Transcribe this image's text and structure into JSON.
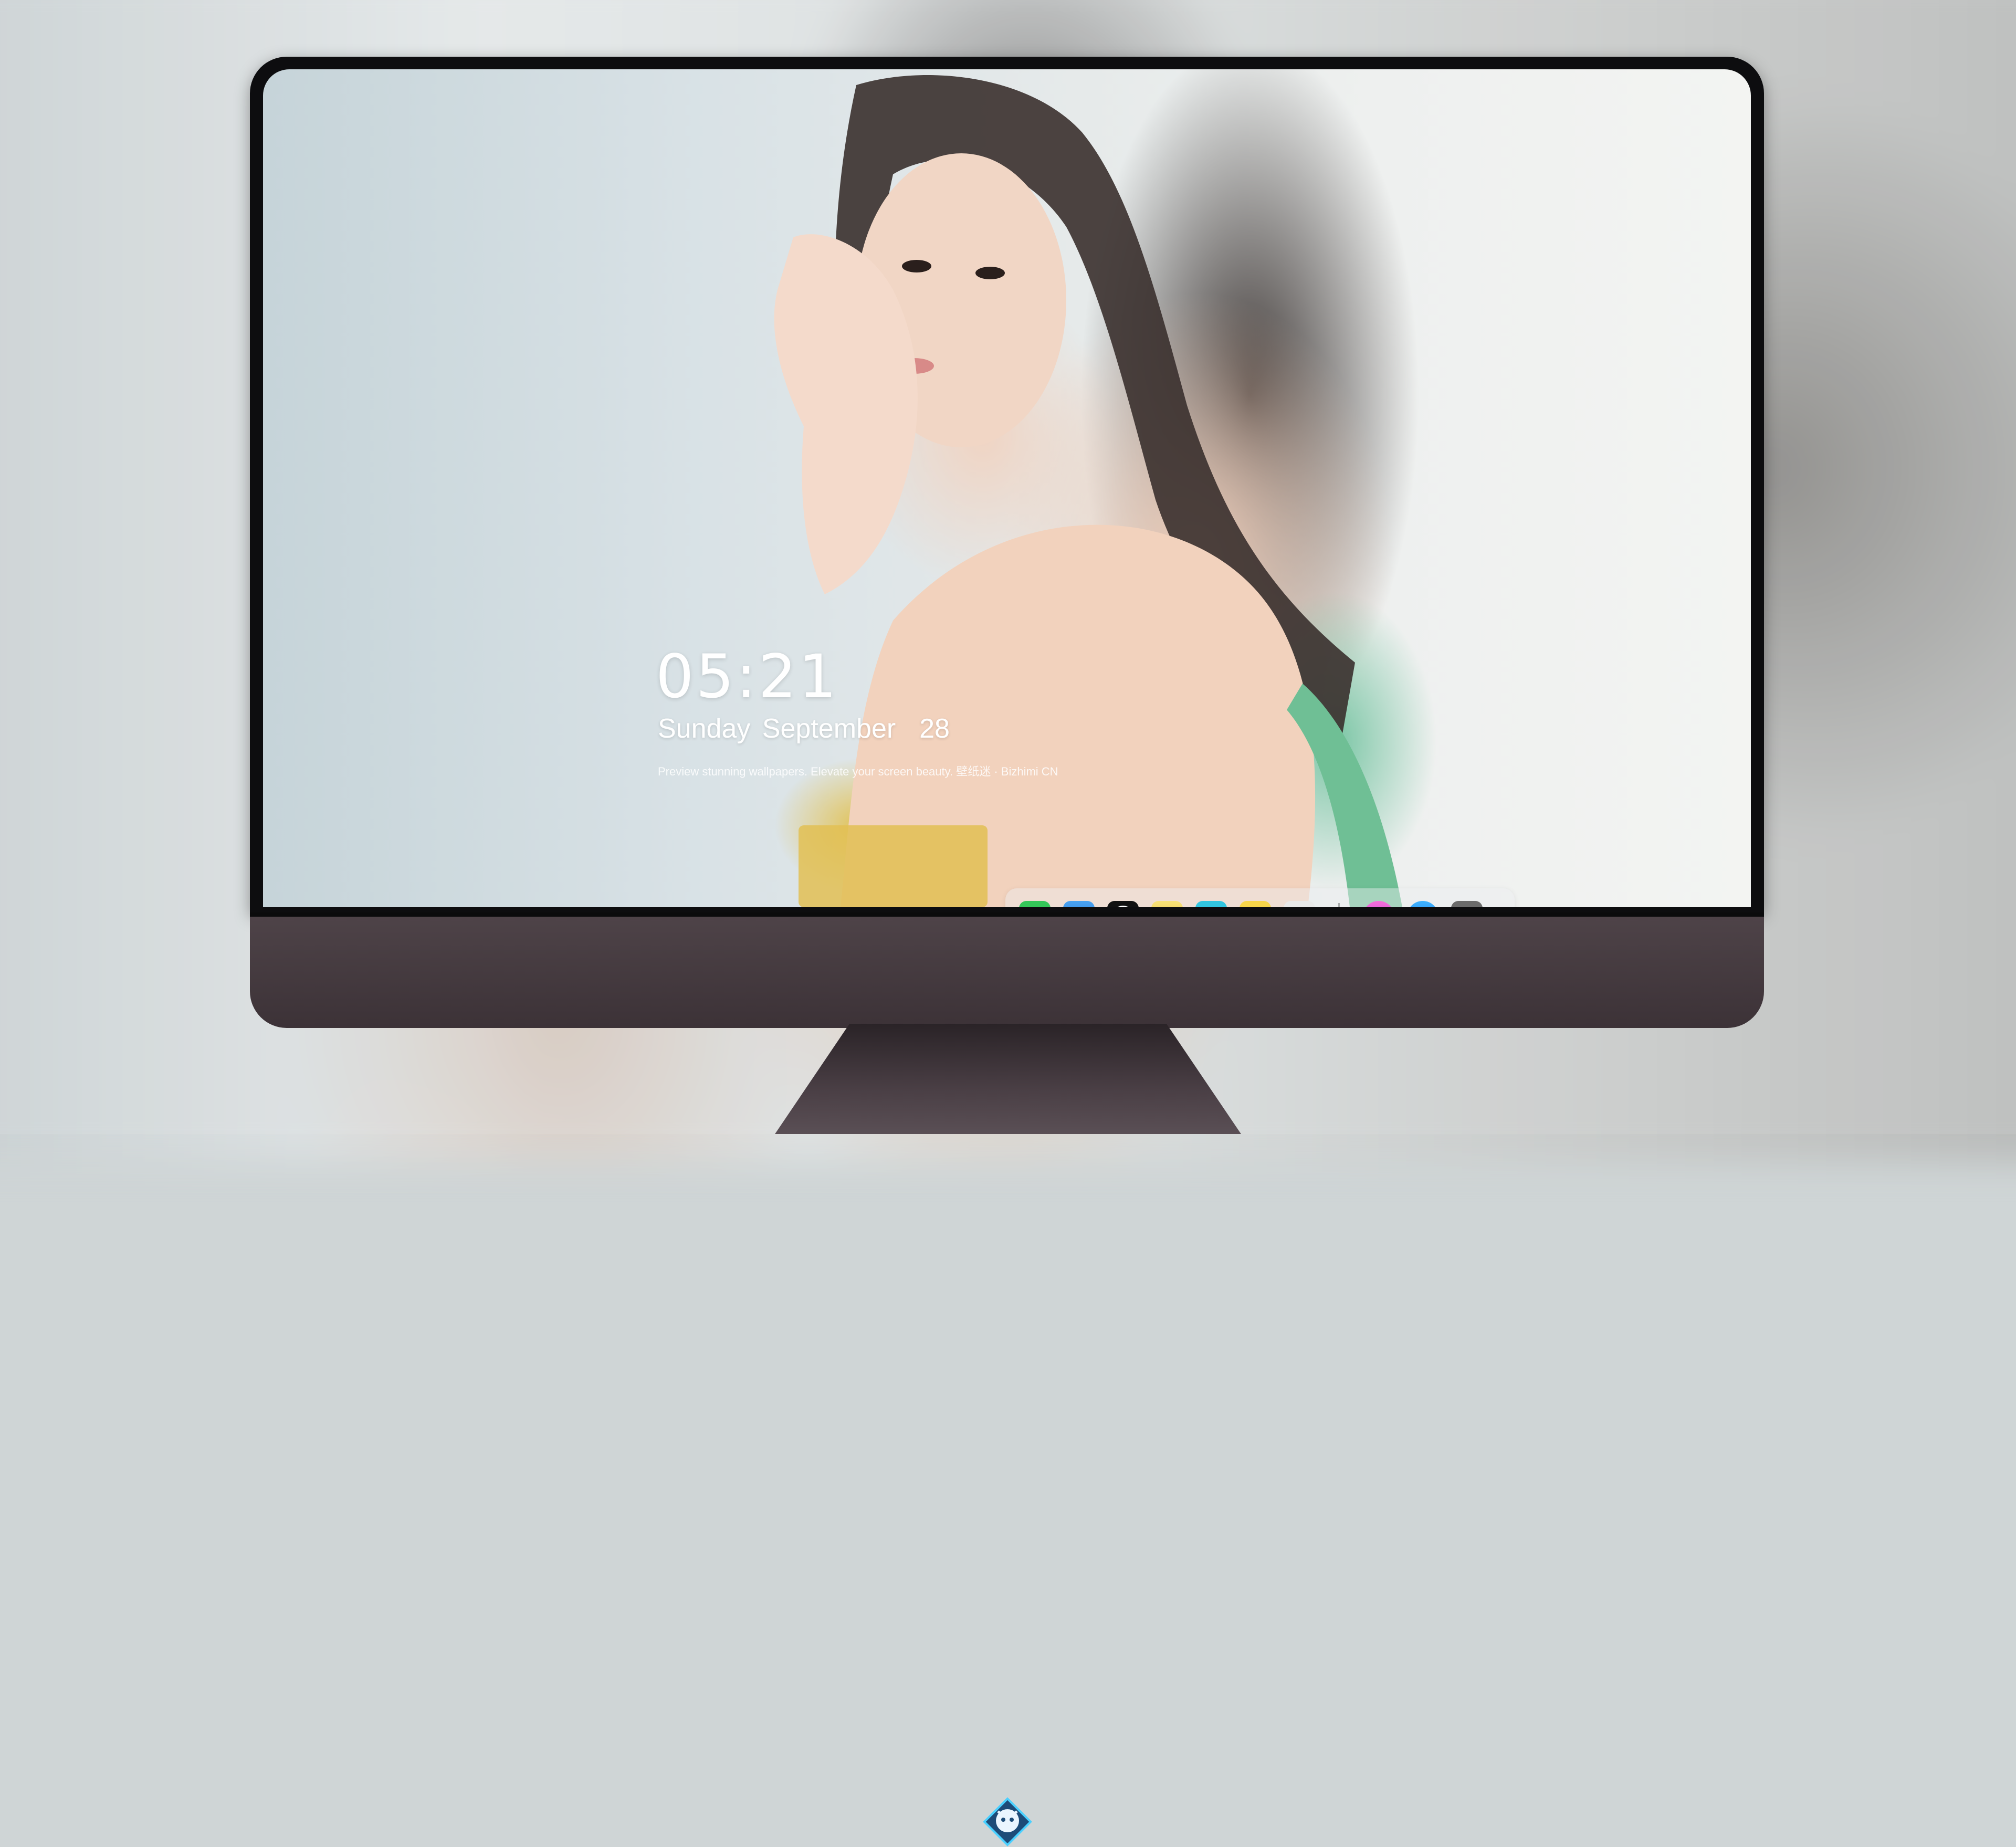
{
  "lockscreen": {
    "time": "05:21",
    "date": "Sunday September  28",
    "caption": "Preview stunning wallpapers. Elevate your screen beauty. 壁纸迷 · Bizhimi CN"
  },
  "dock": {
    "apps": [
      {
        "name": "Messages",
        "icon": "messages-icon",
        "color": "#35c759"
      },
      {
        "name": "Weather",
        "icon": "weather-icon",
        "color": "#3a8ee6"
      },
      {
        "name": "Clock",
        "icon": "clock-icon",
        "color": "#111111"
      },
      {
        "name": "Preview",
        "icon": "preview-icon",
        "color": "#f1c232"
      },
      {
        "name": "Clips",
        "icon": "clips-icon",
        "color": "#32c5e0"
      },
      {
        "name": "Notes",
        "icon": "notes-icon",
        "color": "#f7d54a"
      },
      {
        "name": "Photo Booth",
        "icon": "photo-booth-icon",
        "color": "#e9e9e9"
      }
    ],
    "pinned": [
      {
        "name": "iTunes",
        "icon": "itunes-icon",
        "color": "#e04fd1"
      },
      {
        "name": "App Store",
        "icon": "app-store-icon",
        "color": "#1f8ef1"
      },
      {
        "name": "Screenshot",
        "icon": "camera-icon",
        "color": "#6b6b6b"
      }
    ]
  },
  "brand": {
    "icon": "bizhimi-logo-icon"
  }
}
